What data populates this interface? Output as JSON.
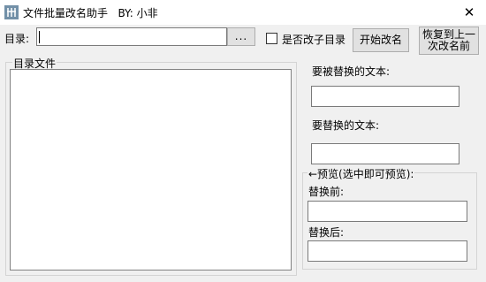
{
  "window": {
    "title": "文件批量改名助手   BY: 小非",
    "close_glyph": "✕"
  },
  "toolbar": {
    "dir_label": "目录:",
    "dir_value": "",
    "browse_label": "...",
    "subdir_checkbox_label": "是否改子目录",
    "subdir_checked": false,
    "start_button": "开始改名",
    "restore_button_line1": "恢复到上一",
    "restore_button_line2": "次改名前"
  },
  "files_group": {
    "title": "目录文件",
    "items": []
  },
  "replace": {
    "find_label": "要被替换的文本:",
    "find_value": "",
    "replace_label": "要替换的文本:",
    "replace_value": ""
  },
  "preview": {
    "title": "←预览(选中即可预览):",
    "before_label": "替换前:",
    "before_value": "",
    "after_label": "替换后:",
    "after_value": ""
  }
}
